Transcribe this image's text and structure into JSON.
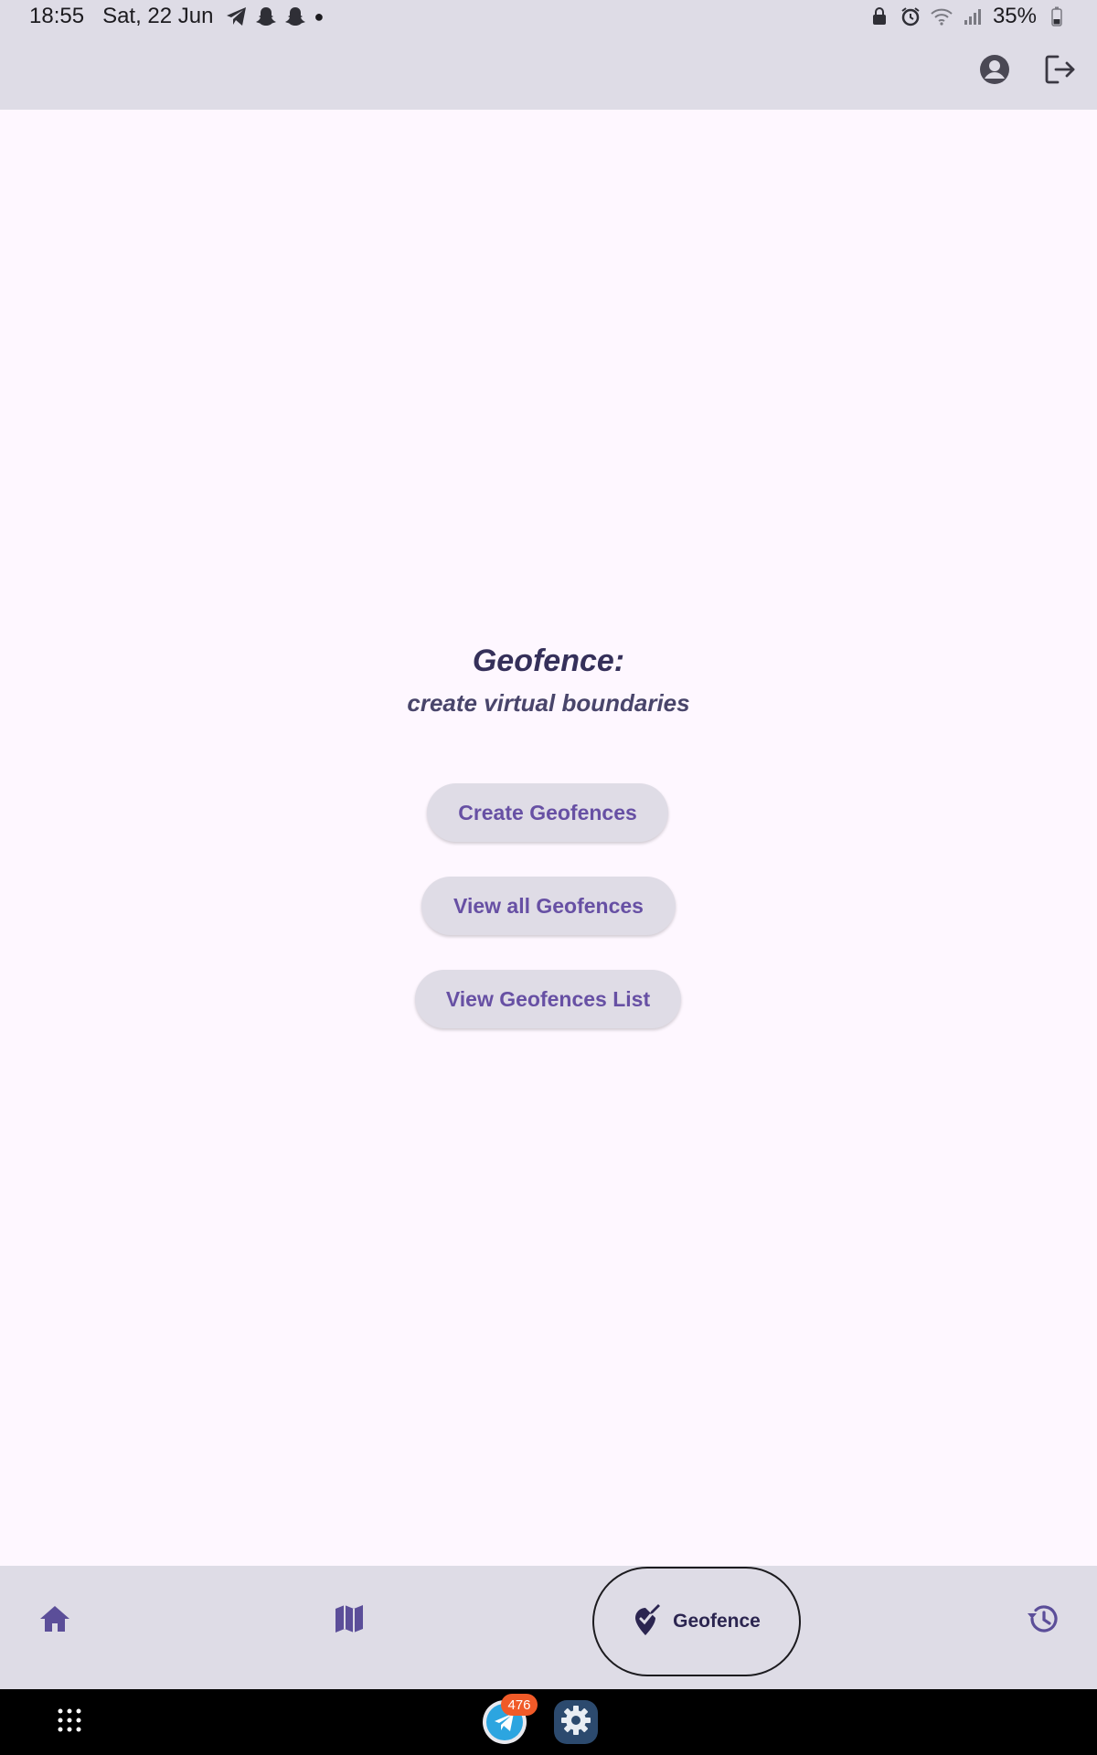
{
  "status_bar": {
    "time": "18:55",
    "date": "Sat, 22 Jun",
    "battery": "35%",
    "notification_icons": [
      "telegram-icon",
      "snapchat-icon",
      "snapchat-icon",
      "dot-icon"
    ],
    "system_icons": [
      "lock-icon",
      "alarm-icon",
      "wifi-icon",
      "signal-icon",
      "battery-icon"
    ]
  },
  "app_bar": {
    "icons": [
      "account-circle-icon",
      "logout-icon"
    ]
  },
  "main": {
    "headline": "Geofence:",
    "subheadline": "create virtual boundaries",
    "buttons": {
      "create": "Create Geofences",
      "view_all": "View all Geofences",
      "view_list": "View Geofences List"
    }
  },
  "bottom_nav": {
    "items": [
      {
        "icon": "home-icon"
      },
      {
        "icon": "map-icon"
      },
      {
        "icon": "geofence-pin-icon",
        "label": "Geofence",
        "active": true
      },
      {
        "icon": "history-icon"
      }
    ]
  },
  "system_bar": {
    "telegram_badge": "476",
    "apps": [
      "app-drawer-icon",
      "telegram-app-icon",
      "settings-app-icon"
    ]
  },
  "colors": {
    "accent": "#6750a4",
    "app_bar_bg": "#dedce6",
    "page_bg": "#fef7ff",
    "button_bg": "#dfdce6",
    "badge": "#f05a28"
  }
}
